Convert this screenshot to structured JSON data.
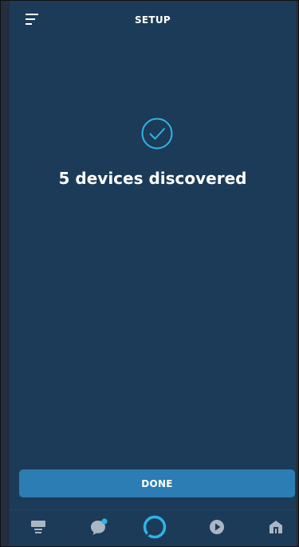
{
  "header": {
    "title": "SETUP",
    "menu_icon": "hamburger-menu-icon"
  },
  "main": {
    "status_icon": "checkmark-circle-icon",
    "headline": "5 devices discovered"
  },
  "footer": {
    "done_label": "DONE"
  },
  "bottom_nav": {
    "items": [
      {
        "icon": "home-icon",
        "active": false
      },
      {
        "icon": "communicate-icon",
        "active": false,
        "badge": true
      },
      {
        "icon": "alexa-icon",
        "active": true
      },
      {
        "icon": "play-icon",
        "active": false
      },
      {
        "icon": "devices-icon",
        "active": false
      }
    ]
  },
  "colors": {
    "background": "#1c3b58",
    "accent": "#2fb4e6",
    "button": "#2c7db3",
    "nav_icon": "#a9b7c4",
    "text": "#ffffff"
  }
}
